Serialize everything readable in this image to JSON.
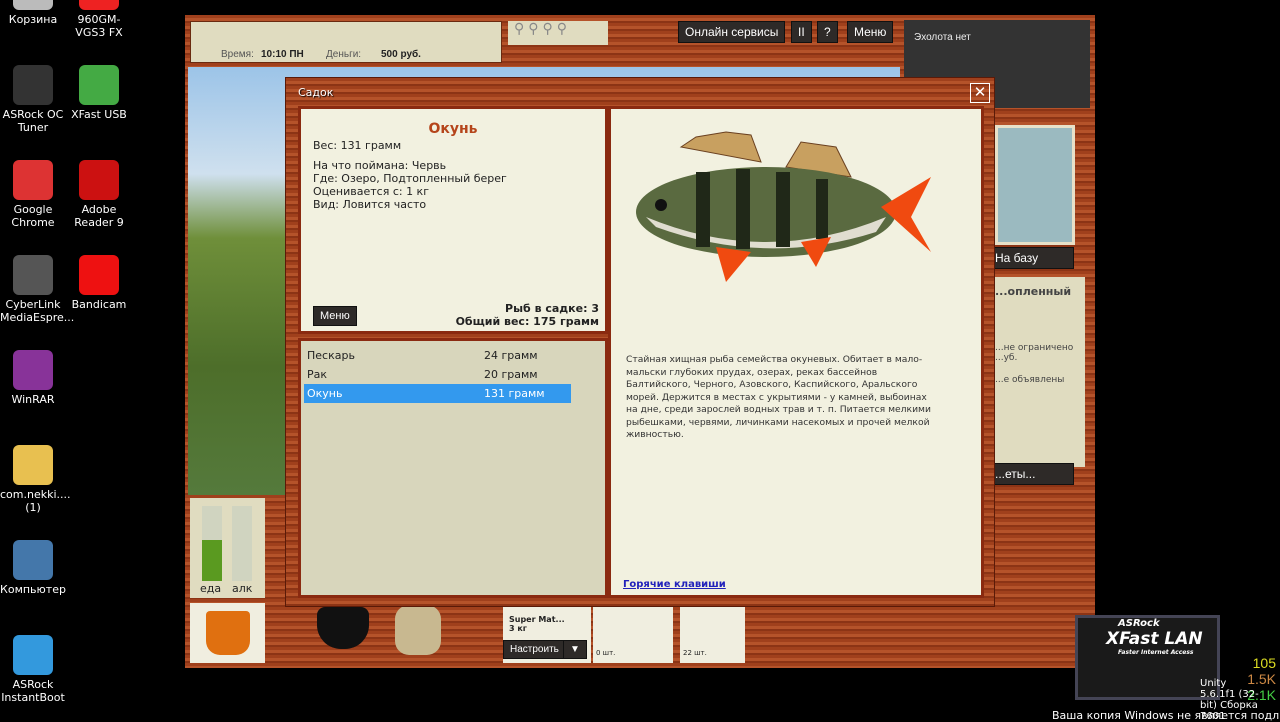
{
  "desktop": {
    "icons": [
      {
        "label": "Корзина",
        "color": "#bbb"
      },
      {
        "label": "960GM-VGS3 FX",
        "color": "#e22"
      },
      {
        "label": "ASRock OC Tuner",
        "color": "#333"
      },
      {
        "label": "XFast USB",
        "color": "#4a4"
      },
      {
        "label": "Google Chrome",
        "color": "#d33"
      },
      {
        "label": "Adobe Reader 9",
        "color": "#c11"
      },
      {
        "label": "CyberLink MediaEspre...",
        "color": "#555"
      },
      {
        "label": "Bandicam",
        "color": "#e11"
      },
      {
        "label": "WinRAR",
        "color": "#839"
      },
      {
        "label": "com.nekki.... (1)",
        "color": "#e8c050"
      },
      {
        "label": "Компьютер",
        "color": "#47a"
      },
      {
        "label": "ASRock InstantBoot",
        "color": "#39d"
      }
    ],
    "watermark": "Ваша копия Windows не является подлинной",
    "unity": "Unity 5.6.1f1 (32-bit) Сборка 7601",
    "xfast": {
      "brand": "ASRock",
      "title": "XFast LAN",
      "subtitle": "Faster Internet Access",
      "v1": "105",
      "v2": "1.5K",
      "v3": "2.1K"
    }
  },
  "game": {
    "status": {
      "time_label": "Время:",
      "time": "10:10 ПН",
      "money_label": "Деньги:",
      "money": "500 руб."
    },
    "toolbar": {
      "online": "Онлайн сервисы",
      "pause": "II",
      "help": "?",
      "menu": "Меню"
    },
    "sonar": "Эхолота нет",
    "side": {
      "to_base": "На базу",
      "place": "...опленный",
      "line1": "...не ограничено",
      "line2": "...уб.",
      "line3": "...е объявлены",
      "more": "...еты..."
    },
    "meters": {
      "food_label": "еда",
      "alc_label": "алк",
      "food": 0.55,
      "alc": 0
    },
    "tackle": {
      "bait_name": "Super Mat...",
      "bait_weight": "3 кг",
      "setup": "Настроить",
      "hooks": "0 шт.",
      "worms": "22 шт."
    }
  },
  "dialog": {
    "title": "Садок",
    "fish": {
      "name": "Окунь",
      "weight": "Вес: 131 грамм",
      "bait": "На что поймана: Червь",
      "where": "Где: Озеро, Подтопленный берег",
      "rated": "Оценивается с: 1 кг",
      "kind": "Вид: Ловится часто"
    },
    "menu": "Меню",
    "count": "Рыб в садке: 3",
    "total": "Общий вес: 175 грамм",
    "catch": [
      {
        "name": "Пескарь",
        "weight": "24 грамм"
      },
      {
        "name": "Рак",
        "weight": "20 грамм"
      },
      {
        "name": "Окунь",
        "weight": "131 грамм",
        "selected": true
      }
    ],
    "description": "Стайная хищная рыба семейства окуневых. Обитает в мало-мальски глубоких прудах, озерах, реках бассейнов Балтийского, Черного, Азовского, Каспийского, Аральского морей. Держится в местах с укрытиями - у камней, выбоинах на дне, среди зарослей водных трав и т. п. Питается мелкими рыбешками, червями, личинками насекомых и прочей мелкой живностью.",
    "hotkeys": "Горячие клавиши",
    "selected_color": "#3399ee"
  }
}
